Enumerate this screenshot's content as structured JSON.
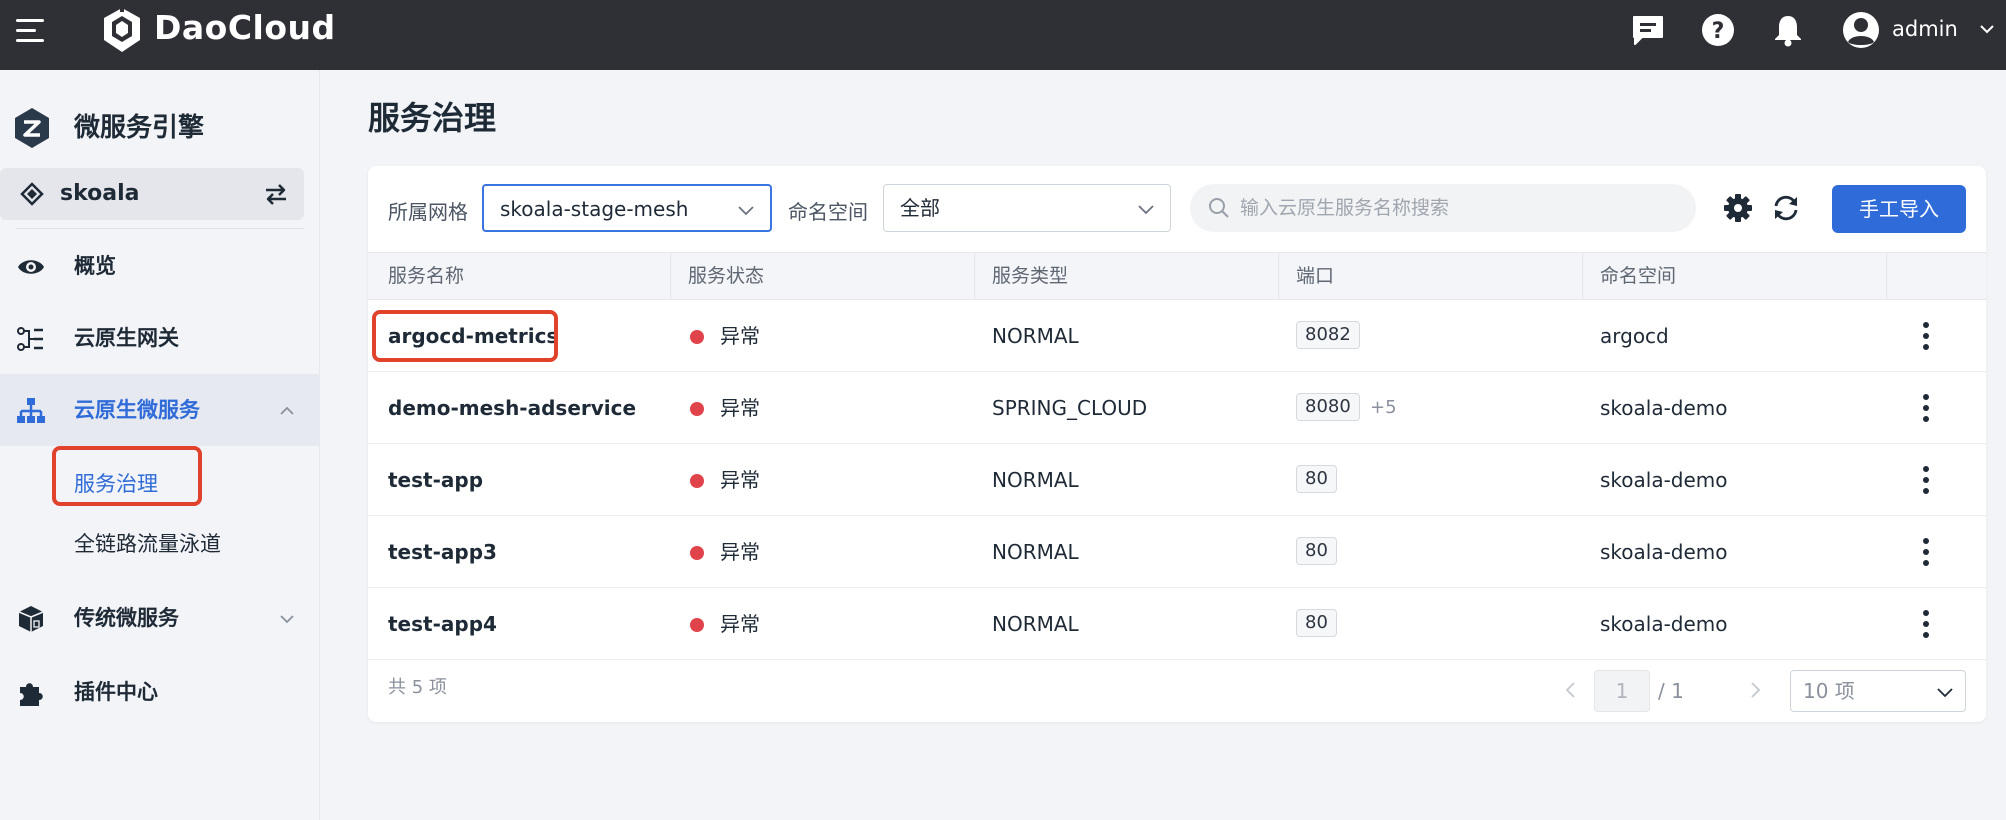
{
  "topbar": {
    "brand": "DaoCloud",
    "user": "admin",
    "icons": [
      "menu-icon",
      "daocloud-logo",
      "message-icon",
      "help-icon",
      "bell-icon",
      "user-avatar-icon",
      "chevron-down-icon"
    ]
  },
  "sidebar": {
    "module_title": "微服务引擎",
    "workspace": "skoala",
    "items": [
      {
        "label": "概览",
        "icon": "eye-icon"
      },
      {
        "label": "云原生网关",
        "icon": "gateway-icon"
      },
      {
        "label": "云原生微服务",
        "icon": "hierarchy-icon",
        "expanded": true,
        "children": [
          {
            "label": "服务治理",
            "active": true
          },
          {
            "label": "全链路流量泳道"
          }
        ]
      },
      {
        "label": "传统微服务",
        "icon": "cube-icon",
        "expanded": false
      },
      {
        "label": "插件中心",
        "icon": "puzzle-icon"
      }
    ]
  },
  "page": {
    "title": "服务治理",
    "toolbar": {
      "mesh_label": "所属网格",
      "mesh_value": "skoala-stage-mesh",
      "namespace_label": "命名空间",
      "namespace_value": "全部",
      "search_placeholder": "输入云原生服务名称搜索",
      "import_button": "手工导入"
    },
    "table": {
      "columns": [
        "服务名称",
        "服务状态",
        "服务类型",
        "端口",
        "命名空间"
      ],
      "rows": [
        {
          "name": "argocd-metrics",
          "status": "异常",
          "type": "NORMAL",
          "port": "8082",
          "port_extra": "",
          "namespace": "argocd"
        },
        {
          "name": "demo-mesh-adservice",
          "status": "异常",
          "type": "SPRING_CLOUD",
          "port": "8080",
          "port_extra": "+5",
          "namespace": "skoala-demo"
        },
        {
          "name": "test-app",
          "status": "异常",
          "type": "NORMAL",
          "port": "80",
          "port_extra": "",
          "namespace": "skoala-demo"
        },
        {
          "name": "test-app3",
          "status": "异常",
          "type": "NORMAL",
          "port": "80",
          "port_extra": "",
          "namespace": "skoala-demo"
        },
        {
          "name": "test-app4",
          "status": "异常",
          "type": "NORMAL",
          "port": "80",
          "port_extra": "",
          "namespace": "skoala-demo"
        }
      ]
    },
    "pagination": {
      "total": "共 5 项",
      "current": "1",
      "of_total": "/ 1",
      "page_size": "10 项"
    }
  },
  "colors": {
    "accent": "#2f6bd9",
    "status_error": "#e0434a",
    "highlight": "#e0422c",
    "topbar": "#2f3035"
  }
}
